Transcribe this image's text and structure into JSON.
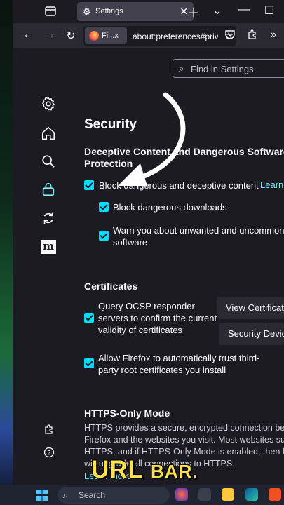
{
  "tabs": [
    {
      "title": "Settings",
      "icon": "gear-icon"
    }
  ],
  "navbar": {
    "identity_label": "Fi...x",
    "url": "about:preferences#privacy"
  },
  "search": {
    "placeholder": "Find in Settings"
  },
  "sidebar": [
    {
      "name": "general",
      "icon": "gear-icon"
    },
    {
      "name": "home",
      "icon": "home-icon"
    },
    {
      "name": "search",
      "icon": "search-icon"
    },
    {
      "name": "privacy",
      "icon": "lock-icon",
      "active": true
    },
    {
      "name": "sync",
      "icon": "sync-icon"
    },
    {
      "name": "more-from-mozilla",
      "icon": "mozilla-icon",
      "label": "m"
    }
  ],
  "page_title": "Security",
  "deceptive": {
    "heading_line1": "Deceptive Content and Dangerous Software",
    "heading_line2": "Protection",
    "block_deceptive": "Block dangerous and deceptive content",
    "learn_more": "Learn m",
    "block_downloads": "Block dangerous downloads",
    "warn_line1": "Warn you about unwanted and uncommon",
    "warn_line2": "software"
  },
  "certificates": {
    "heading": "Certificates",
    "ocsp_line1": "Query OCSP responder",
    "ocsp_line2": "servers to confirm the current",
    "ocsp_line3": "validity of certificates",
    "view_certs": "View Certificates",
    "security_devices": "Security Devices",
    "third_party_line1": "Allow Firefox to automatically trust third-",
    "third_party_line2": "party root certificates you install"
  },
  "https_only": {
    "heading": "HTTPS-Only Mode",
    "line1": "HTTPS provides a secure, encrypted connection between",
    "line2": "Firefox and the websites you visit. Most websites support",
    "line3": "HTTPS, and if HTTPS-Only Mode is enabled, then Firefox",
    "line4": "will upgrade all connections to HTTPS.",
    "learn_more": "Learn more"
  },
  "caption": {
    "big": "URL",
    "small": "BAR."
  },
  "taskbar": {
    "search_label": "Search"
  },
  "colors": {
    "accent": "#00ddff",
    "link": "#80ebff",
    "caption": "#ffe14d"
  }
}
